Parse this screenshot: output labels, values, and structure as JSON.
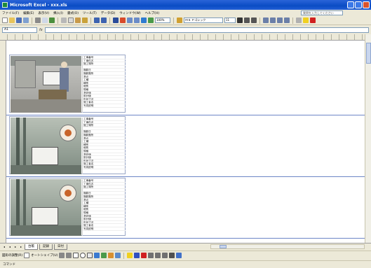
{
  "window": {
    "title": "Microsoft Excel - xxx.xls"
  },
  "menu": {
    "items": [
      "ファイル(F)",
      "編集(E)",
      "表示(V)",
      "挿入(I)",
      "書式(O)",
      "ツール(T)",
      "データ(D)",
      "ウィンドウ(W)",
      "ヘルプ(H)"
    ],
    "help_placeholder": "質問を入力してください"
  },
  "toolbar": {
    "zoom": "100%",
    "font": "ＭＳ Ｐゴシック",
    "font_size": "11"
  },
  "formula_bar": {
    "name_box": "A1",
    "fx": "fx"
  },
  "records": [
    {
      "lines": [
        "工事番号",
        "工事件名",
        "施工場所",
        "",
        "撮影日",
        "撮影箇所",
        "測点",
        "工種",
        "種別",
        "細別",
        "規格",
        "測定値",
        "設計値",
        "形状寸法",
        "施工者名",
        "写真説明"
      ]
    },
    {
      "lines": [
        "工事番号",
        "工事件名",
        "施工場所",
        "",
        "撮影日",
        "撮影箇所",
        "測点",
        "工種",
        "種別",
        "細別",
        "規格",
        "測定値",
        "設計値",
        "形状寸法",
        "施工者名",
        "写真説明"
      ]
    },
    {
      "lines": [
        "工事番号",
        "工事件名",
        "施工場所",
        "",
        "撮影日",
        "撮影箇所",
        "測点",
        "工種",
        "種別",
        "細別",
        "規格",
        "測定値",
        "設計値",
        "形状寸法",
        "施工者名",
        "写真説明"
      ]
    }
  ],
  "sheet_tabs": [
    "台帳",
    "記録",
    "日付"
  ],
  "draw_toolbar": {
    "draw_label": "図形の調整(R)",
    "autoshape_label": "オートシェイプ(U)"
  },
  "status": {
    "text": "コマンド"
  },
  "colors": {
    "titlebar": "#0a4cc4",
    "record_border": "#9aa7c6",
    "separator": "#6d86c6"
  }
}
